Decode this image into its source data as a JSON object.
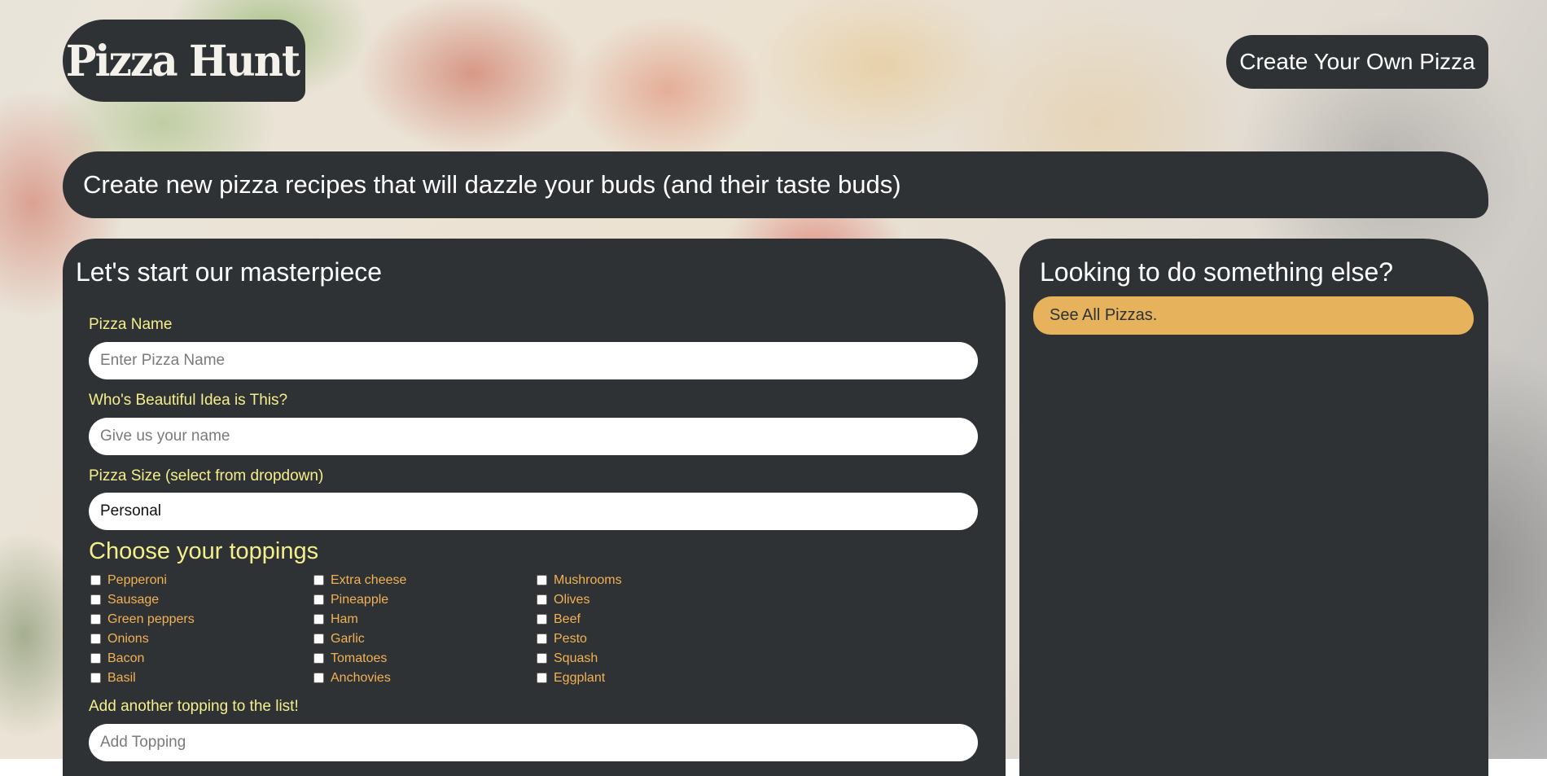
{
  "header": {
    "logo_text": "Pizza Hunt",
    "create_button_label": "Create Your Own Pizza"
  },
  "banner": {
    "text": "Create new pizza recipes that will dazzle your buds (and their taste buds)"
  },
  "form": {
    "heading": "Let's start our masterpiece",
    "pizza_name": {
      "label": "Pizza Name",
      "placeholder": "Enter Pizza Name"
    },
    "creator": {
      "label": "Who's Beautiful Idea is This?",
      "placeholder": "Give us your name"
    },
    "size": {
      "label": "Pizza Size (select from dropdown)",
      "selected": "Personal"
    },
    "toppings_heading": "Choose your toppings",
    "toppings": [
      "Pepperoni",
      "Extra cheese",
      "Mushrooms",
      "Sausage",
      "Pineapple",
      "Olives",
      "Green peppers",
      "Ham",
      "Beef",
      "Onions",
      "Garlic",
      "Pesto",
      "Bacon",
      "Tomatoes",
      "Squash",
      "Basil",
      "Anchovies",
      "Eggplant"
    ],
    "add_topping": {
      "label": "Add another topping to the list!",
      "placeholder": "Add Topping"
    }
  },
  "sidebar": {
    "heading": "Looking to do something else?",
    "see_all_label": "See All Pizzas."
  },
  "colors": {
    "panel": "#2e3235",
    "label_yellow": "#f5ee8c",
    "topping_orange": "#f2b154",
    "accent_button": "#e6b25c"
  }
}
